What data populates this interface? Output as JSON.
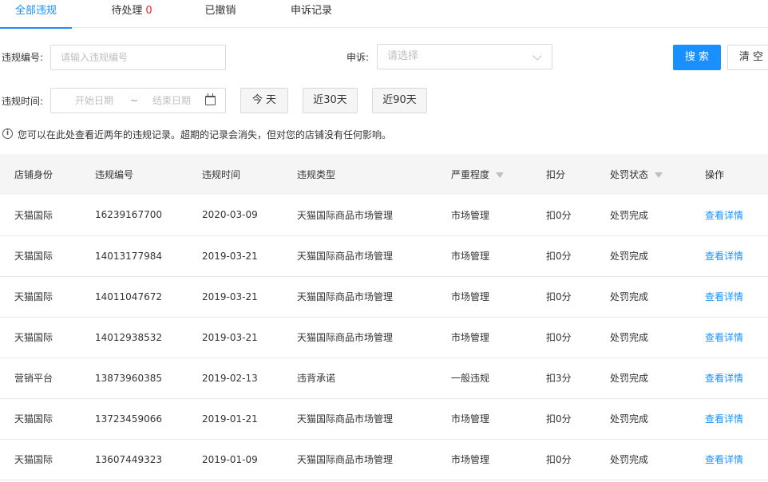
{
  "tabs": [
    {
      "label": "全部违规"
    },
    {
      "label": "待处理",
      "count": "0"
    },
    {
      "label": "已撤销"
    },
    {
      "label": "申诉记录"
    }
  ],
  "form": {
    "violation_no_label": "违规编号:",
    "violation_no_placeholder": "请输入违规编号",
    "appeal_label": "申诉:",
    "appeal_placeholder": "请选择",
    "search_button": "搜 索",
    "clear_button": "清 空",
    "time_label": "违规时间:",
    "start_date_placeholder": "开始日期",
    "range_separator": "~",
    "end_date_placeholder": "结束日期",
    "quick_today": "今 天",
    "quick_30": "近30天",
    "quick_90": "近90天"
  },
  "notice": "您可以在此处查看近两年的违规记录。超期的记录会消失，但对您的店铺没有任何影响。",
  "table": {
    "headers": [
      "店铺身份",
      "违规编号",
      "违规时间",
      "违规类型",
      "严重程度",
      "扣分",
      "处罚状态",
      "操作"
    ],
    "rows": [
      [
        "天猫国际",
        "16239167700",
        "2020-03-09",
        "天猫国际商品市场管理",
        "市场管理",
        "扣0分",
        "处罚完成",
        "查看详情"
      ],
      [
        "天猫国际",
        "14013177984",
        "2019-03-21",
        "天猫国际商品市场管理",
        "市场管理",
        "扣0分",
        "处罚完成",
        "查看详情"
      ],
      [
        "天猫国际",
        "14011047672",
        "2019-03-21",
        "天猫国际商品市场管理",
        "市场管理",
        "扣0分",
        "处罚完成",
        "查看详情"
      ],
      [
        "天猫国际",
        "14012938532",
        "2019-03-21",
        "天猫国际商品市场管理",
        "市场管理",
        "扣0分",
        "处罚完成",
        "查看详情"
      ],
      [
        "营销平台",
        "13873960385",
        "2019-02-13",
        "违背承诺",
        "一般违规",
        "扣3分",
        "处罚完成",
        "查看详情"
      ],
      [
        "天猫国际",
        "13723459066",
        "2019-01-21",
        "天猫国际商品市场管理",
        "市场管理",
        "扣0分",
        "处罚完成",
        "查看详情"
      ],
      [
        "天猫国际",
        "13607449323",
        "2019-01-09",
        "天猫国际商品市场管理",
        "市场管理",
        "扣0分",
        "处罚完成",
        "查看详情"
      ]
    ]
  },
  "colors": {
    "accent": "#1890ff",
    "count": "#f5222d"
  }
}
